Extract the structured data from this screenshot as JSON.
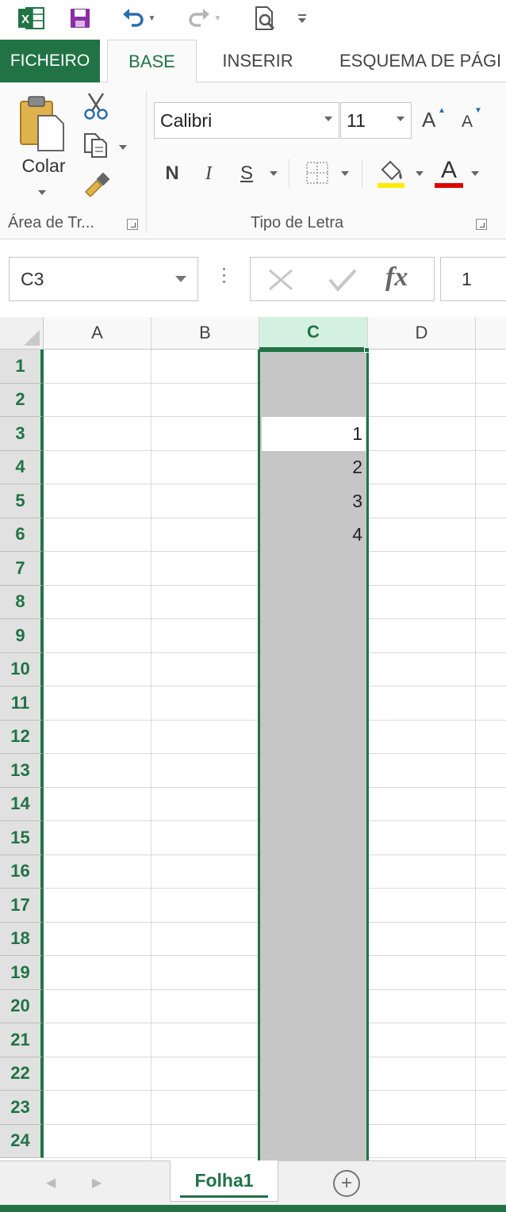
{
  "qat": {
    "app_icon": "excel-logo-icon",
    "app_letter": "X",
    "save_icon": "save-icon",
    "undo_icon": "undo-icon",
    "redo_icon": "redo-icon",
    "preview_icon": "print-preview-icon",
    "customize_icon": "customize-qat-icon"
  },
  "tabs": [
    {
      "label": "FICHEIRO"
    },
    {
      "label": "BASE"
    },
    {
      "label": "INSERIR"
    },
    {
      "label": "ESQUEMA DE PÁGI"
    }
  ],
  "ribbon": {
    "clipboard": {
      "paste_label": "Colar",
      "group_label": "Área de Tr...",
      "cut_icon": "scissors-icon",
      "copy_icon": "copy-icon",
      "format_painter_icon": "paintbrush-icon"
    },
    "font": {
      "font_name": "Calibri",
      "font_size": "11",
      "grow_label": "A",
      "shrink_label": "A",
      "bold_label": "N",
      "italic_label": "I",
      "underline_label": "S",
      "font_color_label": "A",
      "group_label": "Tipo de Letra",
      "fill_color": "#ffeb00",
      "font_color": "#e00000"
    }
  },
  "formula_bar": {
    "name_box": "C3",
    "fx_label": "fx",
    "value": "1"
  },
  "grid": {
    "columns": [
      "A",
      "B",
      "C",
      "D"
    ],
    "selected_column": "C",
    "rows": [
      "1",
      "2",
      "3",
      "4",
      "5",
      "6",
      "7",
      "8",
      "9",
      "10",
      "11",
      "12",
      "13",
      "14",
      "15",
      "16",
      "17",
      "18",
      "19",
      "20",
      "21",
      "22",
      "23",
      "24"
    ],
    "cells": [
      {
        "ref": "C3",
        "value": "1"
      },
      {
        "ref": "C4",
        "value": "2"
      },
      {
        "ref": "C5",
        "value": "3"
      },
      {
        "ref": "C6",
        "value": "4"
      }
    ]
  },
  "sheets": {
    "tabs": [
      {
        "label": "Folha1"
      }
    ],
    "add_label": "+"
  },
  "colors": {
    "accent": "#217346",
    "selection": "#c6c6c6"
  }
}
